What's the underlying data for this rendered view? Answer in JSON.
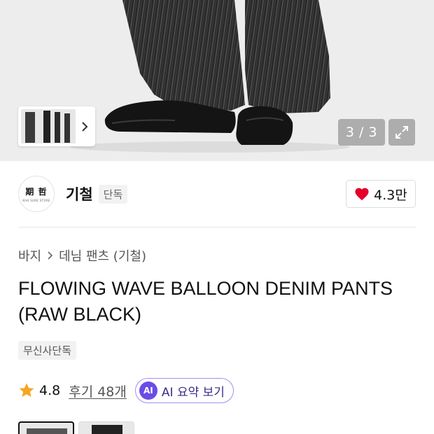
{
  "gallery": {
    "counter": "3 / 3",
    "icons": {
      "next": "chevron-right-icon",
      "expand": "expand-icon"
    }
  },
  "brand": {
    "logo_text": "期 哲",
    "logo_subtext": "KIHI SURE STORE",
    "name": "기철",
    "badge": "단독",
    "like_count": "4.3만",
    "like_color": "#e4002b"
  },
  "breadcrumb": {
    "items": [
      "바지",
      "데님 팬츠 (기철)"
    ]
  },
  "product": {
    "title_line1": "FLOWING WAVE BALLOON DENIM PANTS",
    "title_line2": "(RAW BLACK)",
    "exclusive_tag": "무신사단독"
  },
  "rating": {
    "score": "4.8",
    "reviews": "후기 48개",
    "star_color": "#f5a623"
  },
  "ai_summary": {
    "badge": "AI",
    "label": "AI 요약 보기",
    "accent": "#6b4ce6"
  }
}
